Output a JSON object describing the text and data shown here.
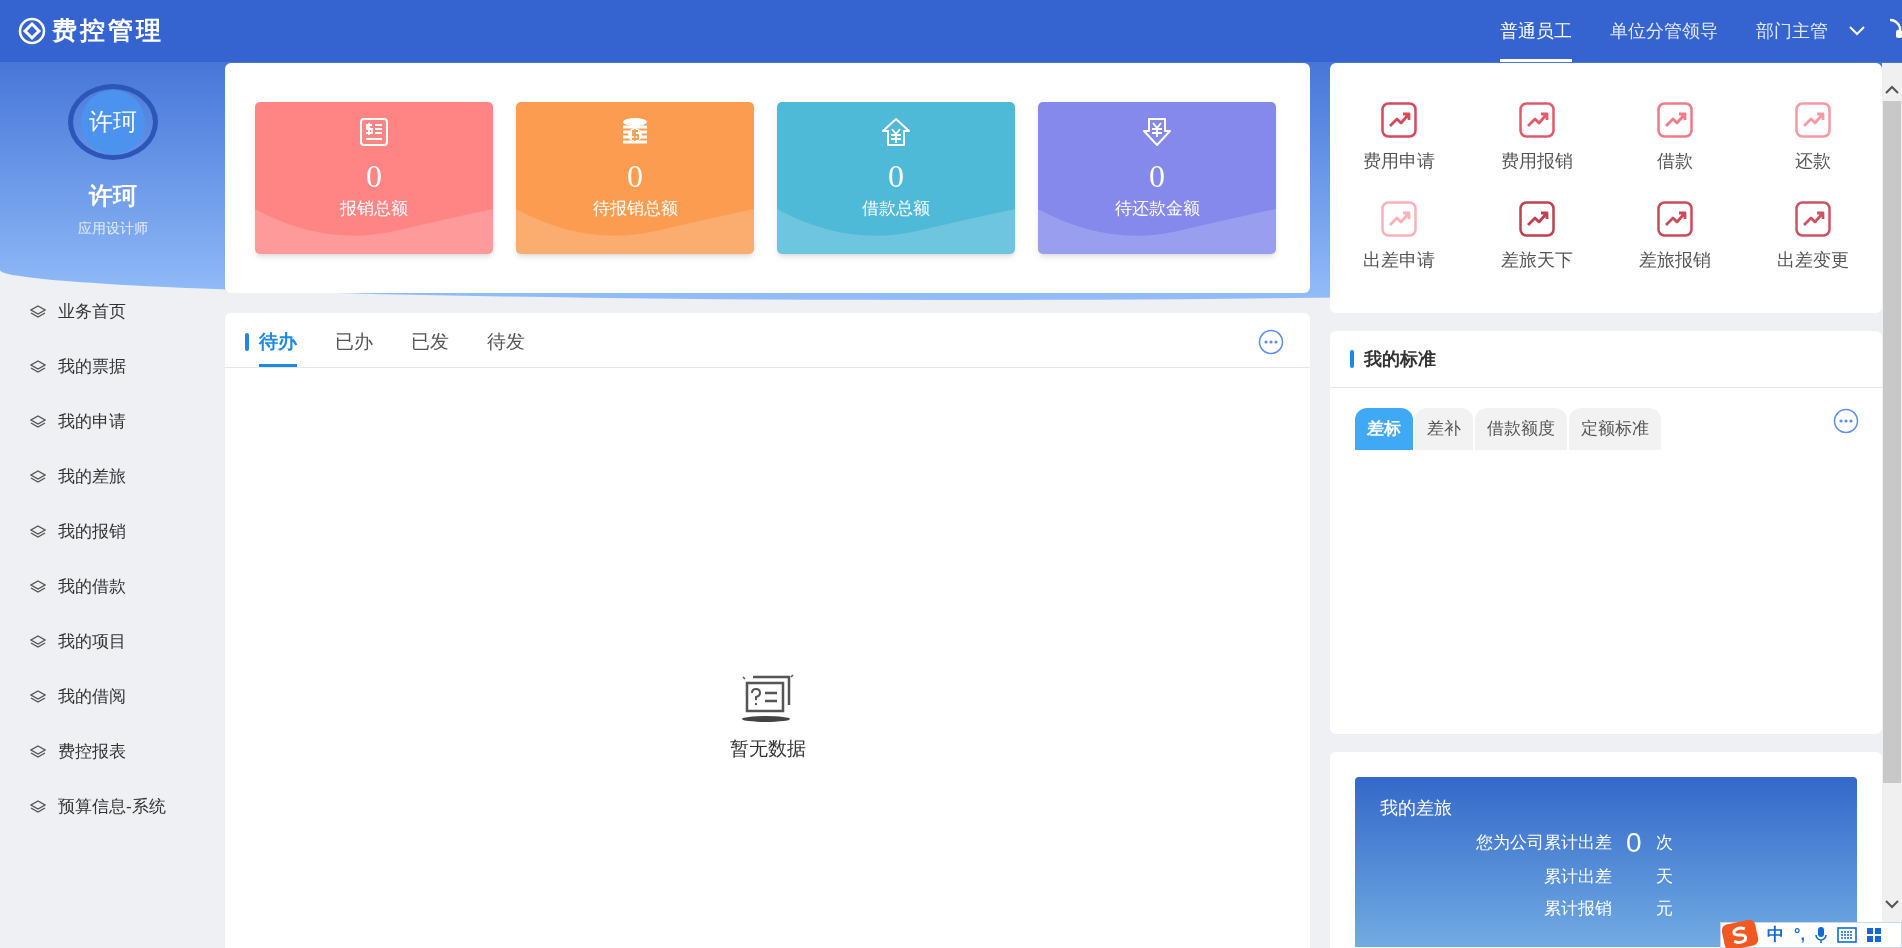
{
  "header": {
    "title": "费控管理",
    "roles": [
      {
        "label": "普通员工",
        "selected": true
      },
      {
        "label": "单位分管领导",
        "selected": false
      },
      {
        "label": "部门主管",
        "selected": false
      }
    ]
  },
  "user": {
    "avatar": "许珂",
    "name": "许珂",
    "role": "应用设计师"
  },
  "sidebar": {
    "items": [
      {
        "label": "业务首页"
      },
      {
        "label": "我的票据"
      },
      {
        "label": "我的申请"
      },
      {
        "label": "我的差旅"
      },
      {
        "label": "我的报销"
      },
      {
        "label": "我的借款"
      },
      {
        "label": "我的项目"
      },
      {
        "label": "我的借阅"
      },
      {
        "label": "费控报表"
      },
      {
        "label": "预算信息-系统"
      }
    ]
  },
  "stats": [
    {
      "kind": "bill",
      "value": "0",
      "label": "报销总额",
      "color": "#fe8584"
    },
    {
      "kind": "coins",
      "value": "0",
      "label": "待报销总额",
      "color": "#fb9c50"
    },
    {
      "kind": "house",
      "value": "0",
      "label": "借款总额",
      "color": "#4fb9d8"
    },
    {
      "kind": "return",
      "value": "0",
      "label": "待还款金额",
      "color": "#8489eb"
    }
  ],
  "tasks": {
    "tabs": [
      {
        "label": "待办",
        "selected": true
      },
      {
        "label": "已办",
        "selected": false
      },
      {
        "label": "已发",
        "selected": false
      },
      {
        "label": "待发",
        "selected": false
      }
    ],
    "empty_text": "暂无数据"
  },
  "shortcuts": [
    {
      "label": "费用申请",
      "color": "#d9475b"
    },
    {
      "label": "费用报销",
      "color": "#e05a6c"
    },
    {
      "label": "借款",
      "color": "#f07a87"
    },
    {
      "label": "还款",
      "color": "#f49aa3"
    },
    {
      "label": "出差申请",
      "color": "#fbb1b8"
    },
    {
      "label": "差旅天下",
      "color": "#c0404f"
    },
    {
      "label": "差旅报销",
      "color": "#c94b5a"
    },
    {
      "label": "出差变更",
      "color": "#cc5462"
    }
  ],
  "standards": {
    "title": "我的标准",
    "tabs": [
      {
        "label": "差标",
        "selected": true
      },
      {
        "label": "差补",
        "selected": false
      },
      {
        "label": "借款额度",
        "selected": false
      },
      {
        "label": "定额标准",
        "selected": false
      }
    ]
  },
  "travel": {
    "title": "我的差旅",
    "rows": [
      {
        "label": "您为公司累计出差",
        "value": "0",
        "unit": "次"
      },
      {
        "label": "累计出差",
        "unit": "天"
      },
      {
        "label": "累计报销",
        "unit": "元"
      }
    ]
  },
  "ime_toolbar": {
    "mode": "中",
    "punctuation": "°,"
  }
}
